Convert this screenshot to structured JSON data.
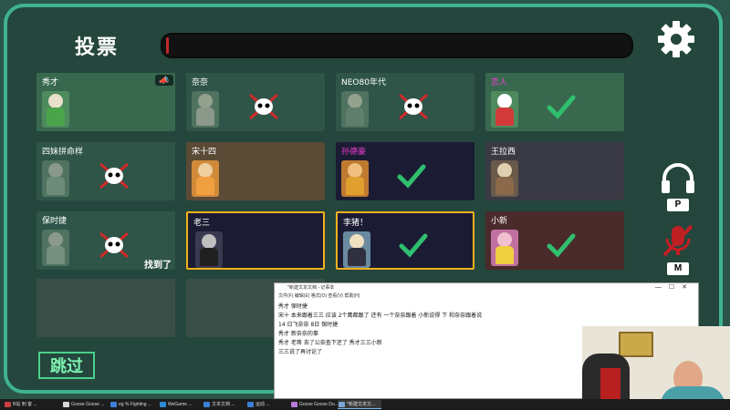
{
  "header": {
    "title": "投票",
    "timer_fraction": 0.006
  },
  "players": [
    {
      "name": "秀才",
      "status": "speaking",
      "speaking_icon": "megaphone-icon",
      "name_color": "#ffffff"
    },
    {
      "name": "奈奈",
      "status": "skipped",
      "name_color": "#ffffff"
    },
    {
      "name": "NEO80年代",
      "status": "skipped",
      "name_color": "#ffffff"
    },
    {
      "name": "恋人",
      "status": "voted",
      "name_color": "#f23cd2"
    },
    {
      "name": "四妹拼命样",
      "status": "skipped",
      "name_color": "#ffffff"
    },
    {
      "name": "宋十四",
      "status": "none",
      "name_color": "#ffffff"
    },
    {
      "name": "孙德豪",
      "status": "voted",
      "name_color": "#f23cd2"
    },
    {
      "name": "王拉西",
      "status": "none",
      "name_color": "#ffffff"
    },
    {
      "name": "保时捷",
      "status": "skipped",
      "extra": "找到了",
      "name_color": "#ffffff"
    },
    {
      "name": "老三",
      "status": "selected",
      "name_color": "#ffffff"
    },
    {
      "name": "李猪！",
      "status": "selected_voted",
      "name_color": "#ffffff"
    },
    {
      "name": "小新",
      "status": "voted",
      "name_color": "#ffffff"
    }
  ],
  "controls": {
    "skip_label": "跳过",
    "push_to_talk_key": "P",
    "mute_key": "M"
  },
  "notepad": {
    "title": "*新建文本文档 - 记事本",
    "menu": "文件(F)  编辑(E)  格式(O)  查看(V)  帮助(H)",
    "lines": [
      "秀才 保时捷",
      "宋十 本来跟着三三    应该 2个鹰都跟了  还有 一个奈奈跟着 小新说得   下 和奈奈跟着说",
      "14 日飞奈奈 8日 保时捷",
      "秀才 新奈奈的事",
      "秀才 老蒋 去了公奈查下还了   秀才三三小新",
      "三三说了再讨论了"
    ]
  },
  "taskbar": {
    "items": [
      {
        "label": "B站 刺 客 ...",
        "color": "#c94040"
      },
      {
        "label": "Goose Goose ...",
        "color": "#d8d8d8"
      },
      {
        "label": "eg % Fighting ...",
        "color": "#3d7fd6"
      },
      {
        "label": "WeGame ...",
        "color": "#2e8bd6"
      },
      {
        "label": "文本文档 ...",
        "color": "#3d7fd6"
      },
      {
        "label": "运动 ...",
        "color": "#3d7fd6"
      },
      {
        "label": "Goose Goose Du...",
        "color": "#b47ad6"
      },
      {
        "label": "*新建文本文...",
        "color": "#79a7d6"
      }
    ]
  },
  "colors": {
    "frame": "#3fb38f",
    "selected_border": "#f2b01e",
    "check": "#2fbf6f",
    "cross": "#d02a2a"
  }
}
